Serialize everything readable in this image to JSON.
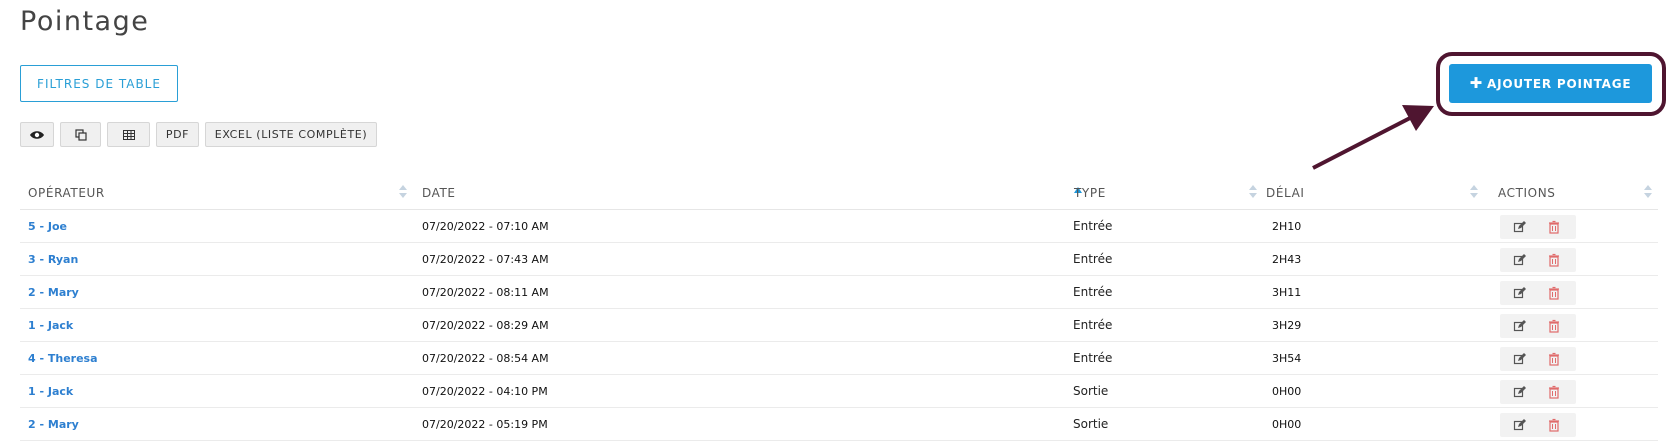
{
  "page": {
    "title": "Pointage"
  },
  "toolbar": {
    "filters_label": "FILTRES DE TABLE",
    "add_label": "AJOUTER POINTAGE",
    "export": [
      {
        "name": "eye-icon",
        "label": ""
      },
      {
        "name": "copy-icon",
        "label": ""
      },
      {
        "name": "table-icon",
        "label": ""
      },
      {
        "name": "pdf",
        "label": "PDF"
      },
      {
        "name": "excel",
        "label": "EXCEL (LISTE COMPLÈTE)"
      }
    ]
  },
  "table": {
    "columns": [
      "OPÉRATEUR",
      "DATE",
      "TYPE",
      "DÉLAI",
      "ACTIONS"
    ],
    "sorted_column": "DATE",
    "sort_direction": "ascending",
    "rows": [
      {
        "operator": "5 - Joe",
        "date": "07/20/2022 - 07:10 AM",
        "type": "Entrée",
        "delay": "2H10"
      },
      {
        "operator": "3 - Ryan",
        "date": "07/20/2022 - 07:43 AM",
        "type": "Entrée",
        "delay": "2H43"
      },
      {
        "operator": "2 - Mary",
        "date": "07/20/2022 - 08:11 AM",
        "type": "Entrée",
        "delay": "3H11"
      },
      {
        "operator": "1 - Jack",
        "date": "07/20/2022 - 08:29 AM",
        "type": "Entrée",
        "delay": "3H29"
      },
      {
        "operator": "4 - Theresa",
        "date": "07/20/2022 - 08:54 AM",
        "type": "Entrée",
        "delay": "3H54"
      },
      {
        "operator": "1 - Jack",
        "date": "07/20/2022 - 04:10 PM",
        "type": "Sortie",
        "delay": "0H00"
      },
      {
        "operator": "2 - Mary",
        "date": "07/20/2022 - 05:19 PM",
        "type": "Sortie",
        "delay": "0H00"
      }
    ]
  },
  "colors": {
    "accent": "#1d98dc",
    "link": "#2d7fd0",
    "annotation": "#4f1530",
    "delete": "#e06b6b"
  },
  "icons": {
    "add": "plus-icon",
    "edit": "edit-icon",
    "delete": "trash-icon"
  }
}
